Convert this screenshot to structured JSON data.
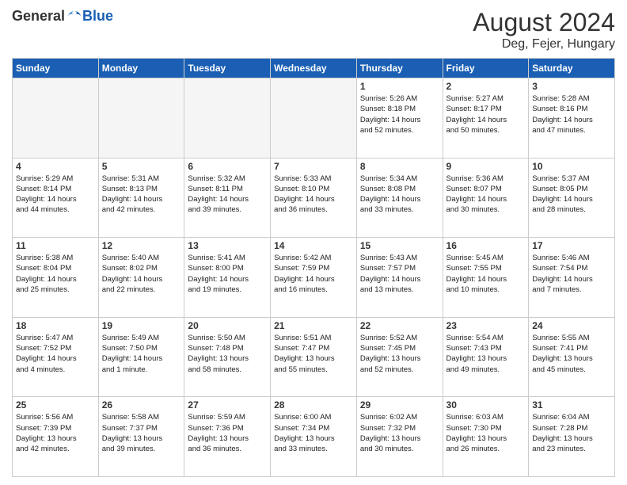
{
  "header": {
    "logo_general": "General",
    "logo_blue": "Blue",
    "month_year": "August 2024",
    "location": "Deg, Fejer, Hungary"
  },
  "weekdays": [
    "Sunday",
    "Monday",
    "Tuesday",
    "Wednesday",
    "Thursday",
    "Friday",
    "Saturday"
  ],
  "weeks": [
    [
      {
        "day": "",
        "info": ""
      },
      {
        "day": "",
        "info": ""
      },
      {
        "day": "",
        "info": ""
      },
      {
        "day": "",
        "info": ""
      },
      {
        "day": "1",
        "info": "Sunrise: 5:26 AM\nSunset: 8:18 PM\nDaylight: 14 hours\nand 52 minutes."
      },
      {
        "day": "2",
        "info": "Sunrise: 5:27 AM\nSunset: 8:17 PM\nDaylight: 14 hours\nand 50 minutes."
      },
      {
        "day": "3",
        "info": "Sunrise: 5:28 AM\nSunset: 8:16 PM\nDaylight: 14 hours\nand 47 minutes."
      }
    ],
    [
      {
        "day": "4",
        "info": "Sunrise: 5:29 AM\nSunset: 8:14 PM\nDaylight: 14 hours\nand 44 minutes."
      },
      {
        "day": "5",
        "info": "Sunrise: 5:31 AM\nSunset: 8:13 PM\nDaylight: 14 hours\nand 42 minutes."
      },
      {
        "day": "6",
        "info": "Sunrise: 5:32 AM\nSunset: 8:11 PM\nDaylight: 14 hours\nand 39 minutes."
      },
      {
        "day": "7",
        "info": "Sunrise: 5:33 AM\nSunset: 8:10 PM\nDaylight: 14 hours\nand 36 minutes."
      },
      {
        "day": "8",
        "info": "Sunrise: 5:34 AM\nSunset: 8:08 PM\nDaylight: 14 hours\nand 33 minutes."
      },
      {
        "day": "9",
        "info": "Sunrise: 5:36 AM\nSunset: 8:07 PM\nDaylight: 14 hours\nand 30 minutes."
      },
      {
        "day": "10",
        "info": "Sunrise: 5:37 AM\nSunset: 8:05 PM\nDaylight: 14 hours\nand 28 minutes."
      }
    ],
    [
      {
        "day": "11",
        "info": "Sunrise: 5:38 AM\nSunset: 8:04 PM\nDaylight: 14 hours\nand 25 minutes."
      },
      {
        "day": "12",
        "info": "Sunrise: 5:40 AM\nSunset: 8:02 PM\nDaylight: 14 hours\nand 22 minutes."
      },
      {
        "day": "13",
        "info": "Sunrise: 5:41 AM\nSunset: 8:00 PM\nDaylight: 14 hours\nand 19 minutes."
      },
      {
        "day": "14",
        "info": "Sunrise: 5:42 AM\nSunset: 7:59 PM\nDaylight: 14 hours\nand 16 minutes."
      },
      {
        "day": "15",
        "info": "Sunrise: 5:43 AM\nSunset: 7:57 PM\nDaylight: 14 hours\nand 13 minutes."
      },
      {
        "day": "16",
        "info": "Sunrise: 5:45 AM\nSunset: 7:55 PM\nDaylight: 14 hours\nand 10 minutes."
      },
      {
        "day": "17",
        "info": "Sunrise: 5:46 AM\nSunset: 7:54 PM\nDaylight: 14 hours\nand 7 minutes."
      }
    ],
    [
      {
        "day": "18",
        "info": "Sunrise: 5:47 AM\nSunset: 7:52 PM\nDaylight: 14 hours\nand 4 minutes."
      },
      {
        "day": "19",
        "info": "Sunrise: 5:49 AM\nSunset: 7:50 PM\nDaylight: 14 hours\nand 1 minute."
      },
      {
        "day": "20",
        "info": "Sunrise: 5:50 AM\nSunset: 7:48 PM\nDaylight: 13 hours\nand 58 minutes."
      },
      {
        "day": "21",
        "info": "Sunrise: 5:51 AM\nSunset: 7:47 PM\nDaylight: 13 hours\nand 55 minutes."
      },
      {
        "day": "22",
        "info": "Sunrise: 5:52 AM\nSunset: 7:45 PM\nDaylight: 13 hours\nand 52 minutes."
      },
      {
        "day": "23",
        "info": "Sunrise: 5:54 AM\nSunset: 7:43 PM\nDaylight: 13 hours\nand 49 minutes."
      },
      {
        "day": "24",
        "info": "Sunrise: 5:55 AM\nSunset: 7:41 PM\nDaylight: 13 hours\nand 45 minutes."
      }
    ],
    [
      {
        "day": "25",
        "info": "Sunrise: 5:56 AM\nSunset: 7:39 PM\nDaylight: 13 hours\nand 42 minutes."
      },
      {
        "day": "26",
        "info": "Sunrise: 5:58 AM\nSunset: 7:37 PM\nDaylight: 13 hours\nand 39 minutes."
      },
      {
        "day": "27",
        "info": "Sunrise: 5:59 AM\nSunset: 7:36 PM\nDaylight: 13 hours\nand 36 minutes."
      },
      {
        "day": "28",
        "info": "Sunrise: 6:00 AM\nSunset: 7:34 PM\nDaylight: 13 hours\nand 33 minutes."
      },
      {
        "day": "29",
        "info": "Sunrise: 6:02 AM\nSunset: 7:32 PM\nDaylight: 13 hours\nand 30 minutes."
      },
      {
        "day": "30",
        "info": "Sunrise: 6:03 AM\nSunset: 7:30 PM\nDaylight: 13 hours\nand 26 minutes."
      },
      {
        "day": "31",
        "info": "Sunrise: 6:04 AM\nSunset: 7:28 PM\nDaylight: 13 hours\nand 23 minutes."
      }
    ]
  ]
}
